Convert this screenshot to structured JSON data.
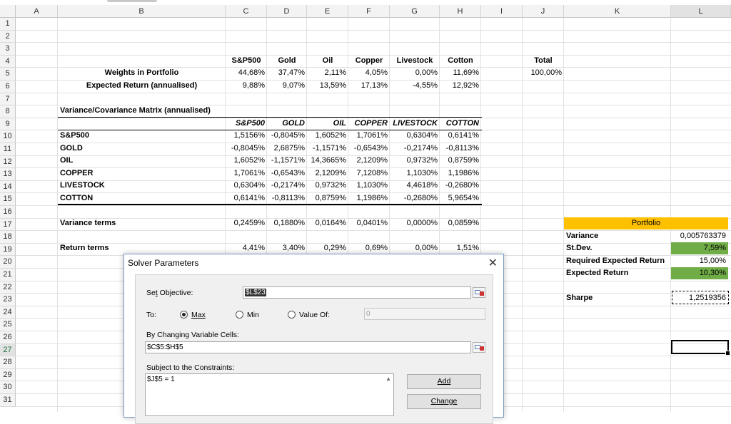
{
  "columns": [
    "A",
    "B",
    "C",
    "D",
    "E",
    "F",
    "G",
    "H",
    "I",
    "J",
    "K",
    "L"
  ],
  "rows": [
    "1",
    "2",
    "3",
    "4",
    "5",
    "6",
    "7",
    "8",
    "9",
    "10",
    "11",
    "12",
    "13",
    "14",
    "15",
    "16",
    "17",
    "18",
    "19",
    "20",
    "21",
    "22",
    "23",
    "24",
    "25",
    "26",
    "27",
    "28",
    "29",
    "30",
    "31"
  ],
  "selected_row": "27",
  "selected_col": "L",
  "assets_header": [
    "S&P500",
    "Gold",
    "Oil",
    "Copper",
    "Livestock",
    "Cotton"
  ],
  "total_label": "Total",
  "weights_label": "Weights in Portfolio",
  "weights": [
    "44,68%",
    "37,47%",
    "2,11%",
    "4,05%",
    "0,00%",
    "11,69%"
  ],
  "total_value": "100,00%",
  "expret_label": "Expected Return (annualised)",
  "expret": [
    "9,88%",
    "9,07%",
    "13,59%",
    "17,13%",
    "-4,55%",
    "12,92%"
  ],
  "matrix_title": "Variance/Covariance Matrix (annualised)",
  "matrix_header": [
    "S&P500",
    "GOLD",
    "OIL",
    "COPPER",
    "LIVESTOCK",
    "COTTON"
  ],
  "matrix_rows": [
    {
      "label": "S&P500",
      "values": [
        "1,5156%",
        "-0,8045%",
        "1,6052%",
        "1,7061%",
        "0,6304%",
        "0,6141%"
      ]
    },
    {
      "label": "GOLD",
      "values": [
        "-0,8045%",
        "2,6875%",
        "-1,1571%",
        "-0,6543%",
        "-0,2174%",
        "-0,8113%"
      ]
    },
    {
      "label": "OIL",
      "values": [
        "1,6052%",
        "-1,1571%",
        "14,3665%",
        "2,1209%",
        "0,9732%",
        "0,8759%"
      ]
    },
    {
      "label": "COPPER",
      "values": [
        "1,7061%",
        "-0,6543%",
        "2,1209%",
        "7,1208%",
        "1,1030%",
        "1,1986%"
      ]
    },
    {
      "label": "LIVESTOCK",
      "values": [
        "0,6304%",
        "-0,2174%",
        "0,9732%",
        "1,1030%",
        "4,4618%",
        "-0,2680%"
      ]
    },
    {
      "label": "COTTON",
      "values": [
        "0,6141%",
        "-0,8113%",
        "0,8759%",
        "1,1986%",
        "-0,2680%",
        "5,9654%"
      ]
    }
  ],
  "variance_terms_label": "Variance terms",
  "variance_terms": [
    "0,2459%",
    "0,1880%",
    "0,0164%",
    "0,0401%",
    "0,0000%",
    "0,0859%"
  ],
  "return_terms_label": "Return terms",
  "return_terms": [
    "4,41%",
    "3,40%",
    "0,29%",
    "0,69%",
    "0,00%",
    "1,51%"
  ],
  "portfolio": {
    "header": "Portfolio",
    "variance_label": "Variance",
    "variance_value": "0,005763379",
    "stdev_label": "St.Dev.",
    "stdev_value": "7,59%",
    "req_label": "Required Expected Return",
    "req_value": "15,00%",
    "exp_label": "Expected Return",
    "exp_value": "10,30%",
    "sharpe_label": "Sharpe",
    "sharpe_value": "1,2519356"
  },
  "colors": {
    "orange": "#ffc000",
    "green": "#70ad47",
    "selection": "#217346"
  },
  "dialog": {
    "title": "Solver Parameters",
    "close_glyph": "✕",
    "set_objective_label_pre": "Se",
    "set_objective_label_u": "t",
    "set_objective_label_post": " Objective:",
    "objective_value": "$L$23",
    "to_label": "To:",
    "max_label": "Max",
    "min_label": "Min",
    "valueof_label": "Value Of:",
    "valueof_value": "0",
    "changing_label": "By Changing Variable Cells:",
    "changing_value": "$C$5:$H$5",
    "constraints_label": "Subject to the Constraints:",
    "constraints": [
      "$J$5 = 1"
    ],
    "add_button": "Add",
    "change_button": "Change"
  }
}
